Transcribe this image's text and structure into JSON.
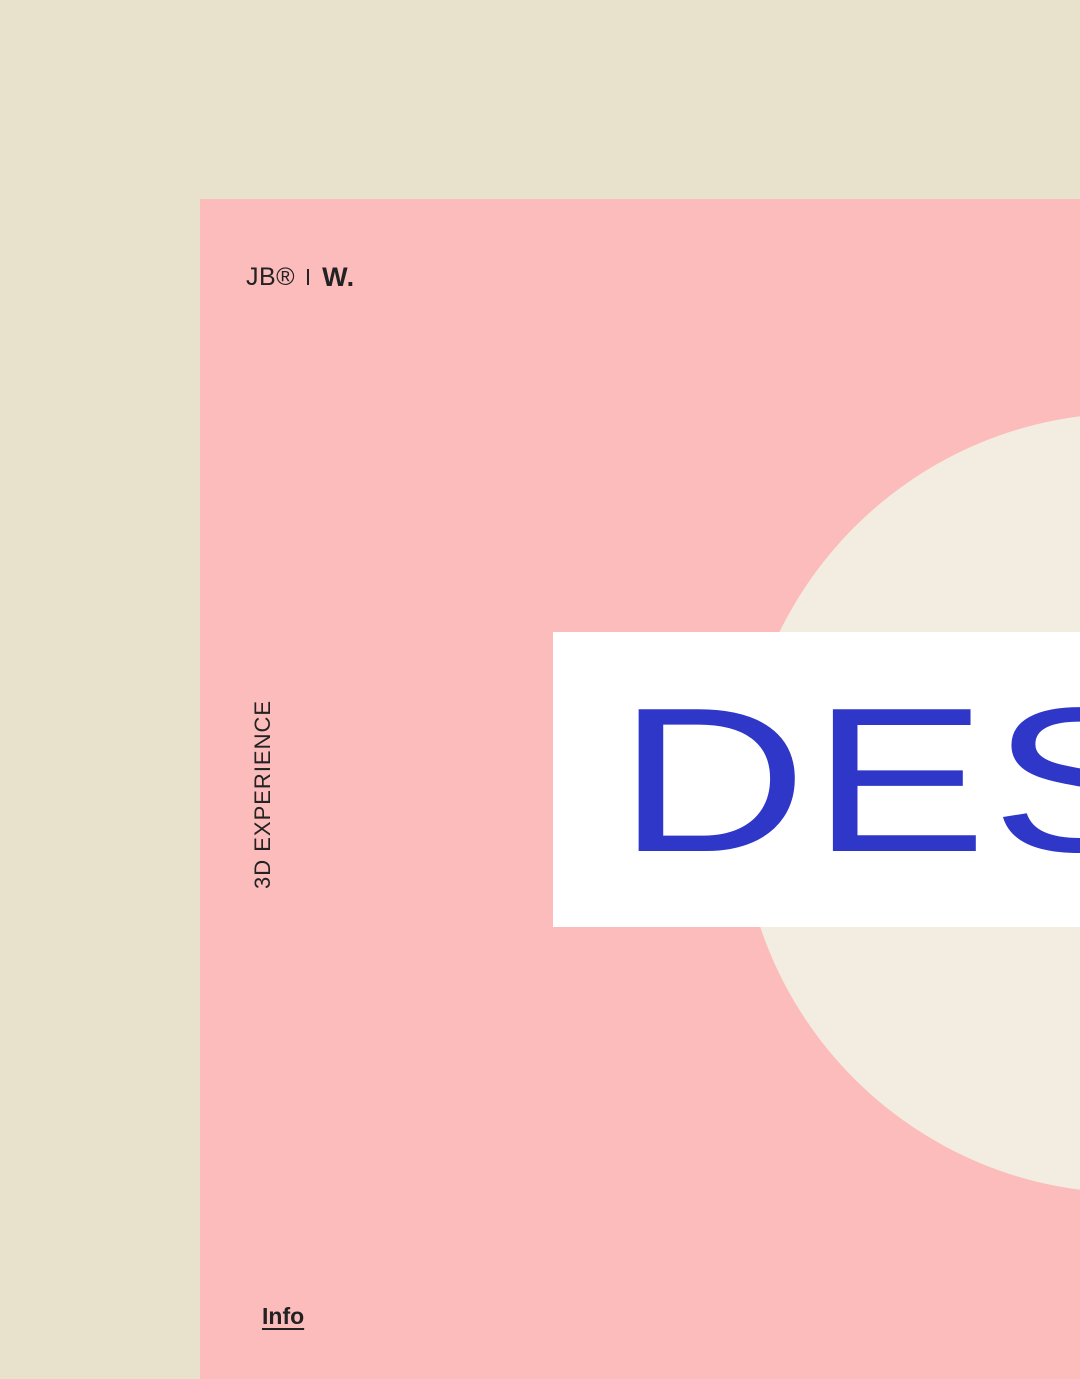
{
  "colors": {
    "outer_background": "#e8e1cb",
    "panel_background": "#fbbcbb",
    "circle": "#f3ede1",
    "hero_box": "#ffffff",
    "hero_text": "#2f37c8",
    "text_dark": "#222222"
  },
  "header": {
    "logo_primary": "JB®",
    "logo_secondary": "W."
  },
  "side_label": "3D EXPERIENCE",
  "hero": {
    "text": "DES"
  },
  "footer": {
    "info_link": "Info"
  }
}
